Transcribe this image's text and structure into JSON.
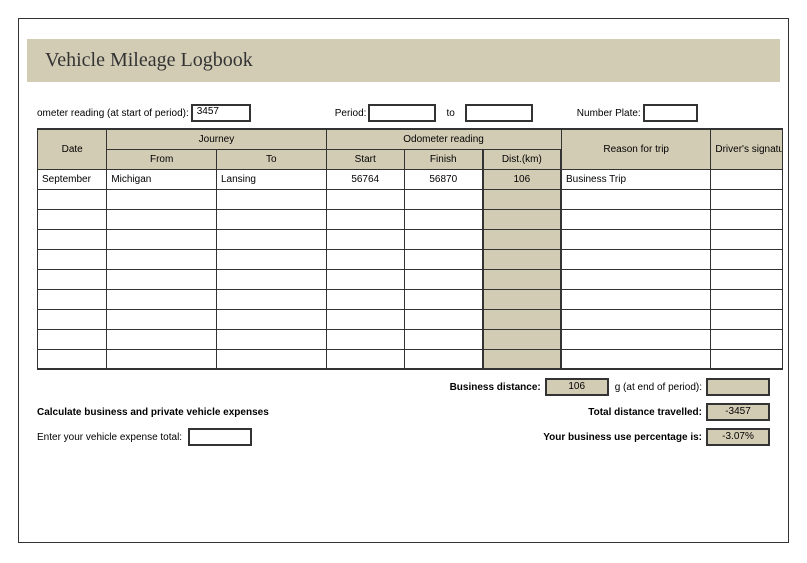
{
  "title": "Vehicle Mileage Logbook",
  "meta": {
    "odometer_label": "ometer reading (at start of period):",
    "odometer_value": "3457",
    "period_label": "Period:",
    "period_from": "",
    "period_sep": "to",
    "period_to": "",
    "plate_label": "Number Plate:",
    "plate_value": ""
  },
  "headers": {
    "date": "Date",
    "journey": "Journey",
    "from": "From",
    "to": "To",
    "odo": "Odometer reading",
    "start": "Start",
    "finish": "Finish",
    "dist": "Dist.(km)",
    "reason": "Reason for trip",
    "sig": "Driver's signature"
  },
  "rows": [
    {
      "date": "September",
      "from": "Michigan",
      "to": "Lansing",
      "start": "56764",
      "finish": "56870",
      "dist": "106",
      "reason": "Business Trip",
      "sig": ""
    },
    {
      "date": "",
      "from": "",
      "to": "",
      "start": "",
      "finish": "",
      "dist": "",
      "reason": "",
      "sig": ""
    },
    {
      "date": "",
      "from": "",
      "to": "",
      "start": "",
      "finish": "",
      "dist": "",
      "reason": "",
      "sig": ""
    },
    {
      "date": "",
      "from": "",
      "to": "",
      "start": "",
      "finish": "",
      "dist": "",
      "reason": "",
      "sig": ""
    },
    {
      "date": "",
      "from": "",
      "to": "",
      "start": "",
      "finish": "",
      "dist": "",
      "reason": "",
      "sig": ""
    },
    {
      "date": "",
      "from": "",
      "to": "",
      "start": "",
      "finish": "",
      "dist": "",
      "reason": "",
      "sig": ""
    },
    {
      "date": "",
      "from": "",
      "to": "",
      "start": "",
      "finish": "",
      "dist": "",
      "reason": "",
      "sig": ""
    },
    {
      "date": "",
      "from": "",
      "to": "",
      "start": "",
      "finish": "",
      "dist": "",
      "reason": "",
      "sig": ""
    },
    {
      "date": "",
      "from": "",
      "to": "",
      "start": "",
      "finish": "",
      "dist": "",
      "reason": "",
      "sig": ""
    },
    {
      "date": "",
      "from": "",
      "to": "",
      "start": "",
      "finish": "",
      "dist": "",
      "reason": "",
      "sig": ""
    }
  ],
  "summary": {
    "bizdist_label": "Business distance:",
    "bizdist_value": "106",
    "endperiod_label": "g (at end of period):",
    "endperiod_value": "",
    "calc_heading": "Calculate business and private vehicle expenses",
    "totaldist_label": "Total distance travelled:",
    "totaldist_value": "-3457",
    "expense_label": "Enter your vehicle expense total:",
    "expense_value": "",
    "pct_label": "Your business use percentage is:",
    "pct_value": "-3.07%"
  }
}
